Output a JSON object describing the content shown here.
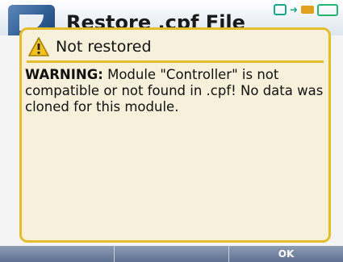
{
  "background_window": {
    "title": "Restore .cpf File"
  },
  "status_icons": [
    "network-icon",
    "arrow-icon",
    "usb-icon",
    "battery-icon"
  ],
  "dialog": {
    "title": "Not restored",
    "icon": "warning-icon",
    "message_label": "WARNING:",
    "message_text": " Module \"Controller\" is not compatible or not found in .cpf! No data was cloned for this module."
  },
  "softkeys": [
    "",
    "",
    "OK"
  ],
  "colors": {
    "dialog_border": "#e3bd2b",
    "dialog_background": "#f7f0da",
    "softkey_bar": "#6f83a2"
  }
}
